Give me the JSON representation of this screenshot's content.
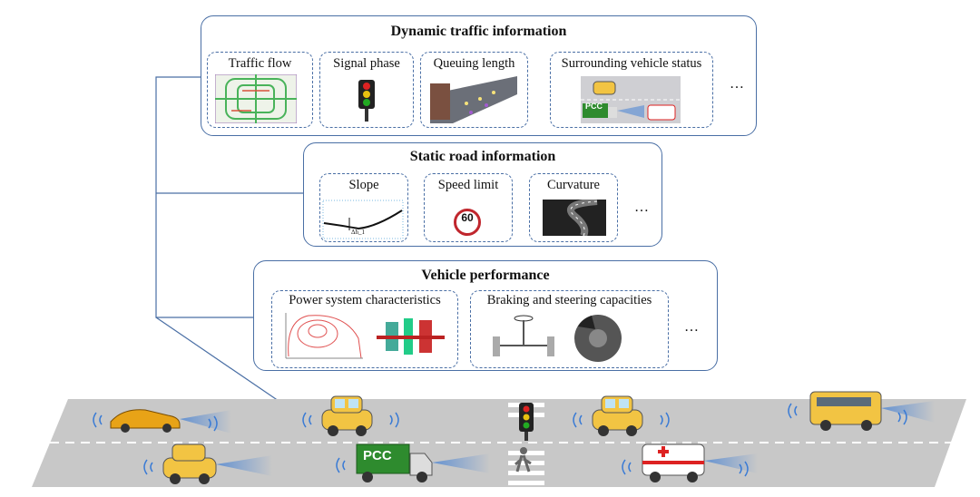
{
  "dynamic": {
    "title": "Dynamic traffic information",
    "items": [
      "Traffic flow",
      "Signal phase",
      "Queuing length",
      "Surrounding vehicle status"
    ],
    "more": "…",
    "pcc_label": "PCC"
  },
  "static": {
    "title": "Static road information",
    "items": [
      "Slope",
      "Speed limit",
      "Curvature"
    ],
    "speed_limit_value": "60",
    "slope_annotation": "Δh_1",
    "more": "…"
  },
  "vehicle": {
    "title": "Vehicle performance",
    "items": [
      "Power system characteristics",
      "Braking and steering capacities"
    ],
    "more": "…"
  },
  "road": {
    "truck_label": "PCC"
  },
  "colors": {
    "border": "#4a6fa5",
    "road": "#c8c8c8",
    "car": "#f2c443",
    "truck": "#2e8b2e",
    "signal_wave": "#3a7bd5"
  }
}
